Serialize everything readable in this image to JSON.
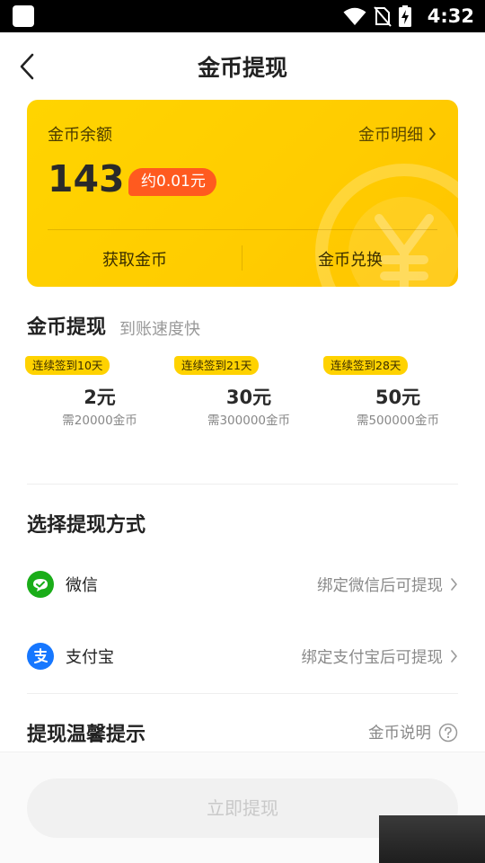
{
  "status_bar": {
    "time": "4:32",
    "icons": [
      "wifi-icon",
      "no-sim-icon",
      "battery-charging-icon"
    ]
  },
  "header": {
    "title": "金币提现",
    "back_icon": "chevron-left-icon"
  },
  "balance_card": {
    "label": "金币余额",
    "detail_link": "金币明细",
    "amount": "143",
    "approx_value": "约0.01元",
    "actions": [
      "获取金币",
      "金币兑换"
    ]
  },
  "withdraw": {
    "title": "金币提现",
    "subtitle": "到账速度快",
    "options": [
      {
        "tag": "连续签到10天",
        "amount": "2元",
        "requirement": "需20000金币"
      },
      {
        "tag": "连续签到21天",
        "amount": "30元",
        "requirement": "需300000金币"
      },
      {
        "tag": "连续签到28天",
        "amount": "50元",
        "requirement": "需500000金币"
      }
    ]
  },
  "methods": {
    "title": "选择提现方式",
    "items": [
      {
        "name": "微信",
        "hint": "绑定微信后可提现",
        "icon": "wechat-icon",
        "color": "#1aad19"
      },
      {
        "name": "支付宝",
        "hint": "绑定支付宝后可提现",
        "icon": "alipay-icon",
        "color": "#1677ff"
      }
    ]
  },
  "tips": {
    "title": "提现温馨提示",
    "help_link": "金币说明"
  },
  "footer": {
    "submit_label": "立即提现"
  },
  "colors": {
    "card_yellow": "#ffcc00",
    "badge_orange": "#ff5a1f",
    "tag_yellow": "#ffd200",
    "disabled_button": "#f1f1f1"
  }
}
